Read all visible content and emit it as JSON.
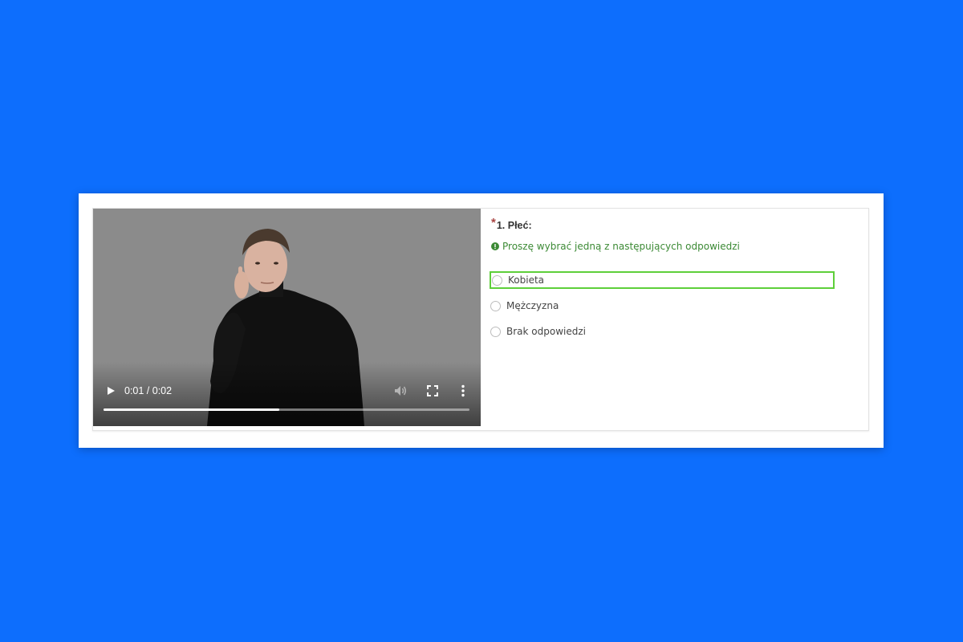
{
  "video": {
    "time": "0:01 / 0:02",
    "progress": 0.48,
    "icons": [
      "play-icon",
      "volume-icon",
      "fullscreen-icon",
      "more-options-icon"
    ]
  },
  "question": {
    "required_mark": "*",
    "title": "1. Płeć:",
    "help_text": "Proszę wybrać jedną z następujących odpowiedzi",
    "answers": [
      {
        "label": "Kobieta",
        "focused": true
      },
      {
        "label": "Mężczyzna",
        "focused": false
      },
      {
        "label": "Brak odpowiedzi",
        "focused": false
      }
    ]
  },
  "colors": {
    "background": "#0d6efd",
    "help_text": "#3c8a35",
    "focus_outline": "#5ecf3a",
    "required": "#a94442"
  }
}
